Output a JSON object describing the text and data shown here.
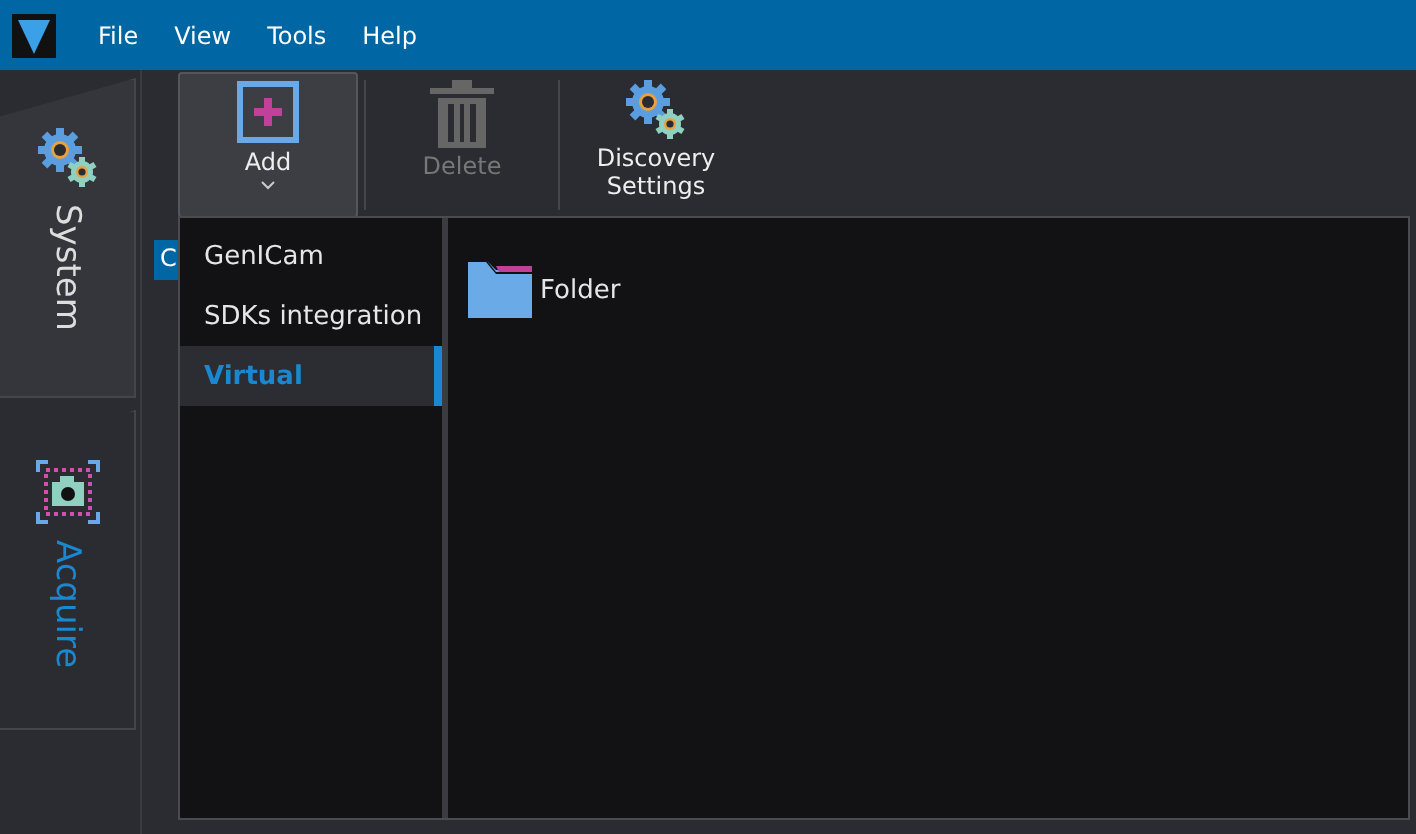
{
  "menu": [
    "File",
    "View",
    "Tools",
    "Help"
  ],
  "sidebar": [
    {
      "label": "System",
      "kind": "system",
      "selected": false
    },
    {
      "label": "Acquire",
      "kind": "acquire",
      "selected": true
    }
  ],
  "toolbar": [
    {
      "label": "Add",
      "kind": "add",
      "disabled": false,
      "dropdown": true
    },
    {
      "label": "Delete",
      "kind": "delete",
      "disabled": true,
      "dropdown": false
    },
    {
      "label": "Discovery Settings",
      "kind": "settings",
      "disabled": false,
      "dropdown": false
    }
  ],
  "hidden_tab": {
    "label": "C"
  },
  "popup": {
    "categories": [
      {
        "label": "GenICam",
        "selected": false
      },
      {
        "label": "SDKs integration",
        "selected": false
      },
      {
        "label": "Virtual",
        "selected": true
      }
    ],
    "items": [
      {
        "label": "Folder"
      }
    ]
  }
}
